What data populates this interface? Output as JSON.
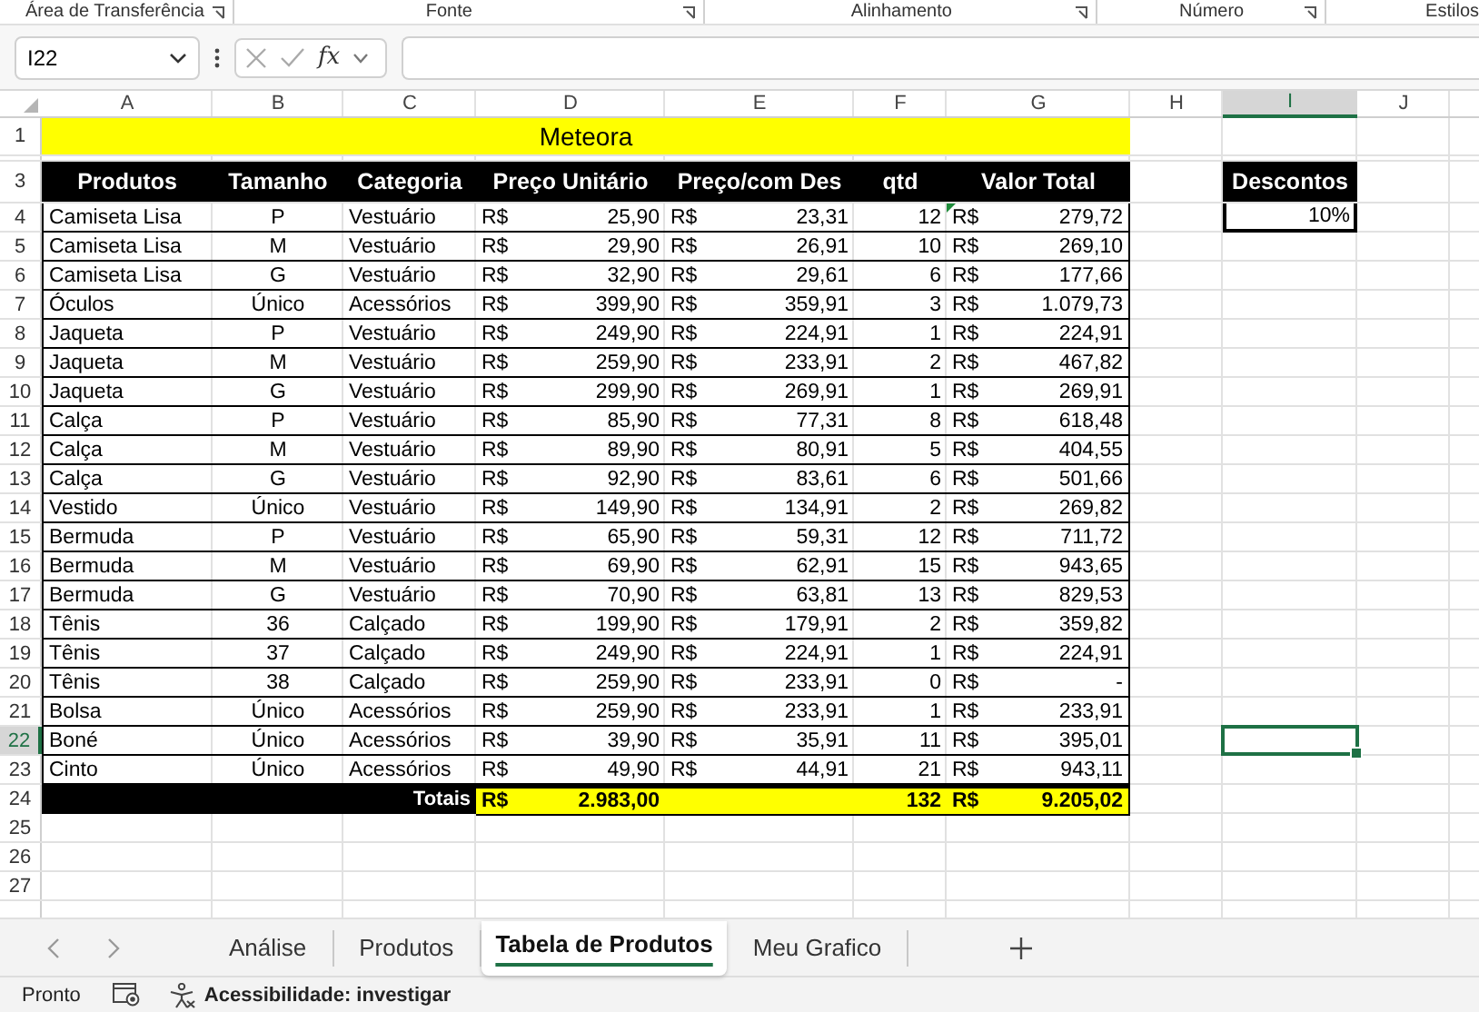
{
  "ribbon_groups": [
    "Área de Transferência",
    "Fonte",
    "Alinhamento",
    "Número",
    "Estilos"
  ],
  "formula_bar": {
    "name_box": "I22",
    "function_label": "fx"
  },
  "sheet": {
    "columns": [
      {
        "label": "A",
        "selected": false
      },
      {
        "label": "B",
        "selected": false
      },
      {
        "label": "C",
        "selected": false
      },
      {
        "label": "D",
        "selected": false
      },
      {
        "label": "E",
        "selected": false
      },
      {
        "label": "F",
        "selected": false
      },
      {
        "label": "G",
        "selected": false
      },
      {
        "label": "H",
        "selected": false
      },
      {
        "label": "I",
        "selected": true
      },
      {
        "label": "J",
        "selected": false
      }
    ]
  },
  "table": {
    "title_row": "1",
    "title": "Meteora",
    "header_row": "3",
    "columns": [
      "Produtos",
      "Tamanho",
      "Categoria",
      "Preço Unitário",
      "Preço/com Des",
      "qtd",
      "Valor Total"
    ],
    "rows": [
      {
        "row": "4",
        "selected": false,
        "flagged": true,
        "produto": "Camiseta Lisa",
        "tamanho": "P",
        "categoria": "Vestuário",
        "preco": [
          "R$",
          "25,90"
        ],
        "preco_desc": [
          "R$",
          "23,31"
        ],
        "qtd": "12",
        "total": [
          "R$",
          "279,72"
        ]
      },
      {
        "row": "5",
        "selected": false,
        "flagged": false,
        "produto": "Camiseta Lisa",
        "tamanho": "M",
        "categoria": "Vestuário",
        "preco": [
          "R$",
          "29,90"
        ],
        "preco_desc": [
          "R$",
          "26,91"
        ],
        "qtd": "10",
        "total": [
          "R$",
          "269,10"
        ]
      },
      {
        "row": "6",
        "selected": false,
        "flagged": false,
        "produto": "Camiseta Lisa",
        "tamanho": "G",
        "categoria": "Vestuário",
        "preco": [
          "R$",
          "32,90"
        ],
        "preco_desc": [
          "R$",
          "29,61"
        ],
        "qtd": "6",
        "total": [
          "R$",
          "177,66"
        ]
      },
      {
        "row": "7",
        "selected": false,
        "flagged": false,
        "produto": "Óculos",
        "tamanho": "Único",
        "categoria": "Acessórios",
        "preco": [
          "R$",
          "399,90"
        ],
        "preco_desc": [
          "R$",
          "359,91"
        ],
        "qtd": "3",
        "total": [
          "R$",
          "1.079,73"
        ]
      },
      {
        "row": "8",
        "selected": false,
        "flagged": false,
        "produto": "Jaqueta",
        "tamanho": "P",
        "categoria": "Vestuário",
        "preco": [
          "R$",
          "249,90"
        ],
        "preco_desc": [
          "R$",
          "224,91"
        ],
        "qtd": "1",
        "total": [
          "R$",
          "224,91"
        ]
      },
      {
        "row": "9",
        "selected": false,
        "flagged": false,
        "produto": "Jaqueta",
        "tamanho": "M",
        "categoria": "Vestuário",
        "preco": [
          "R$",
          "259,90"
        ],
        "preco_desc": [
          "R$",
          "233,91"
        ],
        "qtd": "2",
        "total": [
          "R$",
          "467,82"
        ]
      },
      {
        "row": "10",
        "selected": false,
        "flagged": false,
        "produto": "Jaqueta",
        "tamanho": "G",
        "categoria": "Vestuário",
        "preco": [
          "R$",
          "299,90"
        ],
        "preco_desc": [
          "R$",
          "269,91"
        ],
        "qtd": "1",
        "total": [
          "R$",
          "269,91"
        ]
      },
      {
        "row": "11",
        "selected": false,
        "flagged": false,
        "produto": "Calça",
        "tamanho": "P",
        "categoria": "Vestuário",
        "preco": [
          "R$",
          "85,90"
        ],
        "preco_desc": [
          "R$",
          "77,31"
        ],
        "qtd": "8",
        "total": [
          "R$",
          "618,48"
        ]
      },
      {
        "row": "12",
        "selected": false,
        "flagged": false,
        "produto": "Calça",
        "tamanho": "M",
        "categoria": "Vestuário",
        "preco": [
          "R$",
          "89,90"
        ],
        "preco_desc": [
          "R$",
          "80,91"
        ],
        "qtd": "5",
        "total": [
          "R$",
          "404,55"
        ]
      },
      {
        "row": "13",
        "selected": false,
        "flagged": false,
        "produto": "Calça",
        "tamanho": "G",
        "categoria": "Vestuário",
        "preco": [
          "R$",
          "92,90"
        ],
        "preco_desc": [
          "R$",
          "83,61"
        ],
        "qtd": "6",
        "total": [
          "R$",
          "501,66"
        ]
      },
      {
        "row": "14",
        "selected": false,
        "flagged": false,
        "produto": "Vestido",
        "tamanho": "Único",
        "categoria": "Vestuário",
        "preco": [
          "R$",
          "149,90"
        ],
        "preco_desc": [
          "R$",
          "134,91"
        ],
        "qtd": "2",
        "total": [
          "R$",
          "269,82"
        ]
      },
      {
        "row": "15",
        "selected": false,
        "flagged": false,
        "produto": "Bermuda",
        "tamanho": "P",
        "categoria": "Vestuário",
        "preco": [
          "R$",
          "65,90"
        ],
        "preco_desc": [
          "R$",
          "59,31"
        ],
        "qtd": "12",
        "total": [
          "R$",
          "711,72"
        ]
      },
      {
        "row": "16",
        "selected": false,
        "flagged": false,
        "produto": "Bermuda",
        "tamanho": "M",
        "categoria": "Vestuário",
        "preco": [
          "R$",
          "69,90"
        ],
        "preco_desc": [
          "R$",
          "62,91"
        ],
        "qtd": "15",
        "total": [
          "R$",
          "943,65"
        ]
      },
      {
        "row": "17",
        "selected": false,
        "flagged": false,
        "produto": "Bermuda",
        "tamanho": "G",
        "categoria": "Vestuário",
        "preco": [
          "R$",
          "70,90"
        ],
        "preco_desc": [
          "R$",
          "63,81"
        ],
        "qtd": "13",
        "total": [
          "R$",
          "829,53"
        ]
      },
      {
        "row": "18",
        "selected": false,
        "flagged": false,
        "produto": "Tênis",
        "tamanho": "36",
        "categoria": "Calçado",
        "preco": [
          "R$",
          "199,90"
        ],
        "preco_desc": [
          "R$",
          "179,91"
        ],
        "qtd": "2",
        "total": [
          "R$",
          "359,82"
        ]
      },
      {
        "row": "19",
        "selected": false,
        "flagged": false,
        "produto": "Tênis",
        "tamanho": "37",
        "categoria": "Calçado",
        "preco": [
          "R$",
          "249,90"
        ],
        "preco_desc": [
          "R$",
          "224,91"
        ],
        "qtd": "1",
        "total": [
          "R$",
          "224,91"
        ]
      },
      {
        "row": "20",
        "selected": false,
        "flagged": false,
        "produto": "Tênis",
        "tamanho": "38",
        "categoria": "Calçado",
        "preco": [
          "R$",
          "259,90"
        ],
        "preco_desc": [
          "R$",
          "233,91"
        ],
        "qtd": "0",
        "total": [
          "R$",
          "-"
        ]
      },
      {
        "row": "21",
        "selected": false,
        "flagged": false,
        "produto": "Bolsa",
        "tamanho": "Único",
        "categoria": "Acessórios",
        "preco": [
          "R$",
          "259,90"
        ],
        "preco_desc": [
          "R$",
          "233,91"
        ],
        "qtd": "1",
        "total": [
          "R$",
          "233,91"
        ]
      },
      {
        "row": "22",
        "selected": true,
        "flagged": false,
        "produto": "Boné",
        "tamanho": "Único",
        "categoria": "Acessórios",
        "preco": [
          "R$",
          "39,90"
        ],
        "preco_desc": [
          "R$",
          "35,91"
        ],
        "qtd": "11",
        "total": [
          "R$",
          "395,01"
        ]
      },
      {
        "row": "23",
        "selected": false,
        "flagged": false,
        "produto": "Cinto",
        "tamanho": "Único",
        "categoria": "Acessórios",
        "preco": [
          "R$",
          "49,90"
        ],
        "preco_desc": [
          "R$",
          "44,91"
        ],
        "qtd": "21",
        "total": [
          "R$",
          "943,11"
        ]
      }
    ],
    "totals": {
      "row": "24",
      "label": "Totais",
      "preco": [
        "R$",
        "2.983,00"
      ],
      "qtd": "132",
      "total": [
        "R$",
        "9.205,02"
      ]
    }
  },
  "discount": {
    "label": "Descontos",
    "value": "10%"
  },
  "empty_rows": [
    {
      "row": "25",
      "selected": false
    },
    {
      "row": "26",
      "selected": false
    },
    {
      "row": "27",
      "selected": false
    }
  ],
  "sheet_tabs": [
    {
      "label": "Análise",
      "selected": false
    },
    {
      "label": "Produtos",
      "selected": false
    },
    {
      "label": "Tabela de Produtos",
      "selected": true
    },
    {
      "label": "Meu Grafico",
      "selected": false
    }
  ],
  "status_bar": {
    "status": "Pronto",
    "accessibility": "Acessibilidade: investigar"
  }
}
